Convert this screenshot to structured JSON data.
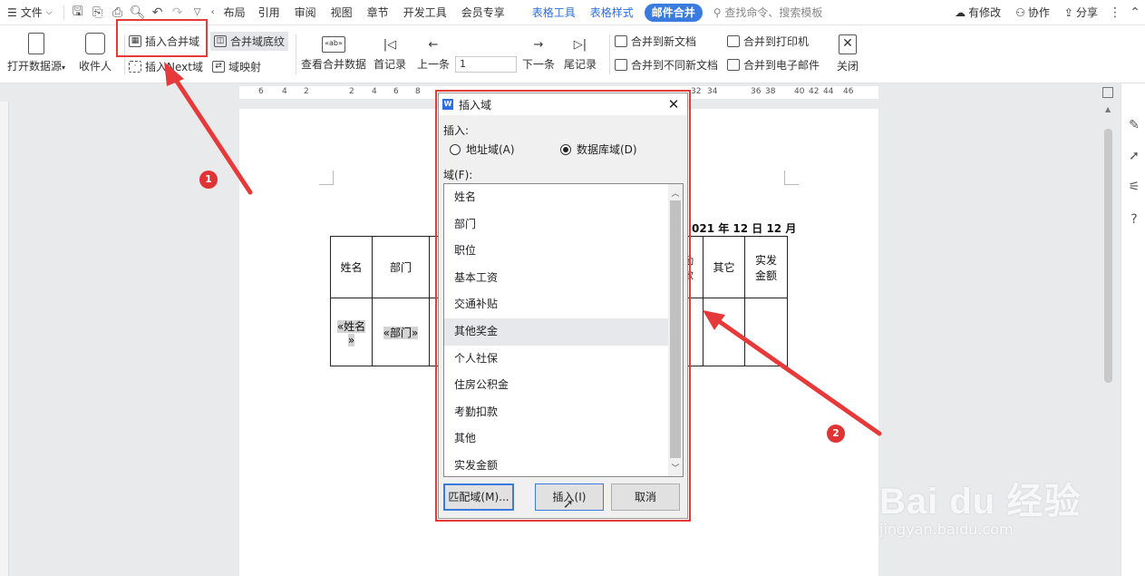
{
  "menubar": {
    "file": "文件",
    "tabs": [
      "布局",
      "引用",
      "审阅",
      "视图",
      "章节",
      "开发工具",
      "会员专享"
    ],
    "context_tabs": [
      "表格工具",
      "表格样式"
    ],
    "active_tab": "邮件合并",
    "search": "查找命令、搜索模板",
    "right": [
      "有修改",
      "协作",
      "分享"
    ]
  },
  "ribbon": {
    "open_source": "打开数据源",
    "recipient": "收件人",
    "insert_merge_field": "插入合并域",
    "merge_field_shading": "合并域底纹",
    "insert_next": "插入Next域",
    "field_mapping": "域映射",
    "view_merge_data": "查看合并数据",
    "first_record": "首记录",
    "prev_record": "上一条",
    "record_number": "1",
    "next_record": "下一条",
    "last_record": "尾记录",
    "merge_new_doc": "合并到新文档",
    "merge_diff_docs": "合并到不同新文档",
    "merge_printer": "合并到打印机",
    "merge_email": "合并到电子邮件",
    "close": "关闭"
  },
  "ruler": {
    "ticks": [
      "6",
      "4",
      "2",
      "2",
      "4",
      "6",
      "8",
      "32",
      "34",
      "36",
      "38",
      "40",
      "42",
      "44",
      "46"
    ]
  },
  "document": {
    "date": "021 年 12 日 12 月",
    "headers": {
      "name": "姓名",
      "dept": "部门",
      "absence_line1": "勤",
      "absence_line2": "款",
      "other": "其它",
      "actual_line1": "实发",
      "actual_line2": "金额"
    },
    "fields": {
      "name_line1": "«姓名",
      "name_line2": "»",
      "dept": "«部门»"
    }
  },
  "dialog": {
    "title": "插入域",
    "insert_label": "插入:",
    "radio_address": "地址域(A)",
    "radio_database": "数据库域(D)",
    "selected_radio": "database",
    "field_label": "域(F):",
    "fields": [
      "姓名",
      "部门",
      "职位",
      "基本工资",
      "交通补贴",
      "其他奖金",
      "个人社保",
      "住房公积金",
      "考勤扣款",
      "其他",
      "实发金额"
    ],
    "selected_field": "其他奖金",
    "btn_match": "匹配域(M)...",
    "btn_insert": "插入(I)",
    "btn_cancel": "取消"
  },
  "annotations": {
    "badge1": "1",
    "badge2": "2",
    "color": "#e63a3a"
  },
  "watermark": {
    "main": "Bai du 经验",
    "sub": "jingyan.baidu.com"
  },
  "colors": {
    "accent": "#3a7be0",
    "context_tab": "#2d6fdc"
  }
}
